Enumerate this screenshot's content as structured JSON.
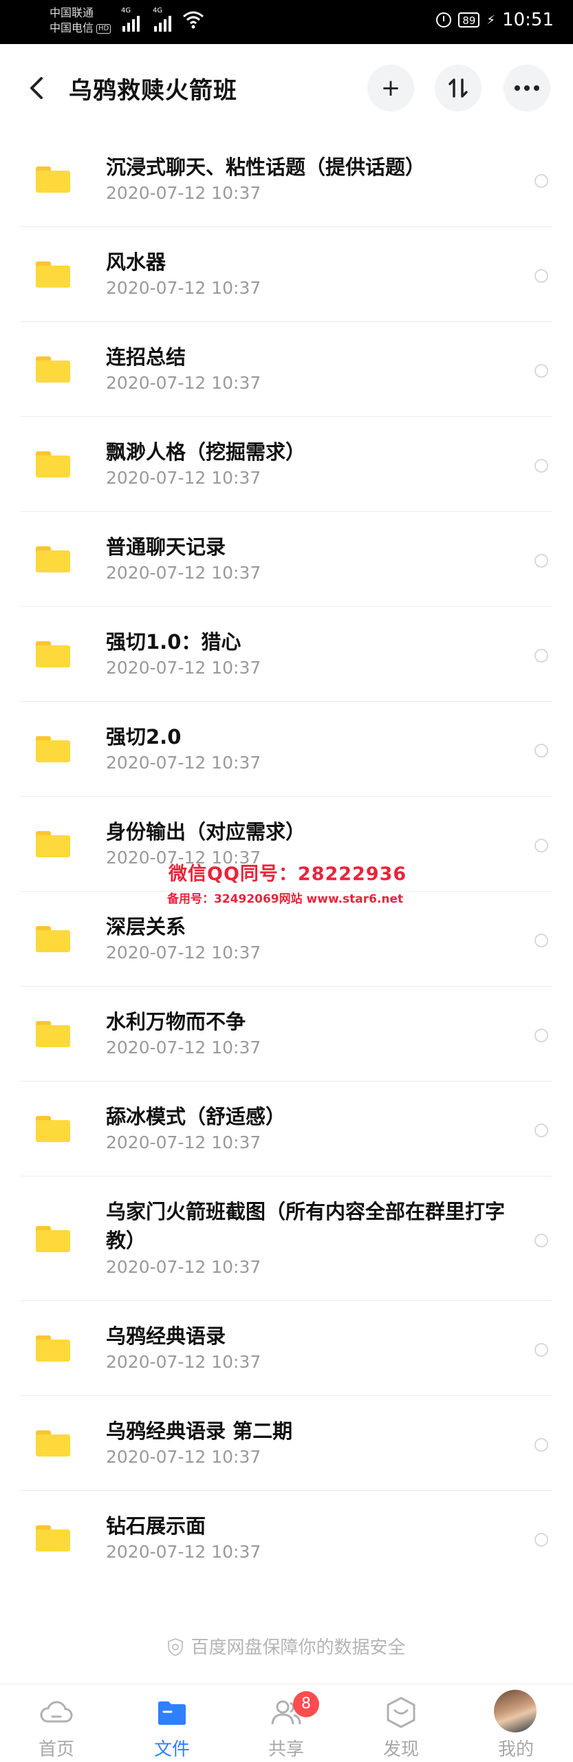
{
  "status_bar": {
    "carrier1": "中国联通",
    "carrier2": "中国电信",
    "hd": "HD",
    "net1": "4G",
    "net2": "4G",
    "battery": "89",
    "time": "10:51"
  },
  "header": {
    "title": "乌鸦救赎火箭班",
    "add_label": "+",
    "sort_label": "⇅",
    "more_label": "•••"
  },
  "files": [
    {
      "name": "沉浸式聊天、粘性话题（提供话题）",
      "date": "2020-07-12  10:37"
    },
    {
      "name": "风水器",
      "date": "2020-07-12  10:37"
    },
    {
      "name": "连招总结",
      "date": "2020-07-12  10:37"
    },
    {
      "name": "飘渺人格（挖掘需求）",
      "date": "2020-07-12  10:37"
    },
    {
      "name": "普通聊天记录",
      "date": "2020-07-12  10:37"
    },
    {
      "name": "强切1.0：猎心",
      "date": "2020-07-12  10:37"
    },
    {
      "name": "强切2.0",
      "date": "2020-07-12  10:37"
    },
    {
      "name": "身份输出（对应需求）",
      "date": "2020-07-12  10:37"
    },
    {
      "name": "深层关系",
      "date": "2020-07-12  10:37"
    },
    {
      "name": "水利万物而不争",
      "date": "2020-07-12  10:37"
    },
    {
      "name": "舔冰模式（舒适感）",
      "date": "2020-07-12  10:37"
    },
    {
      "name": "乌家门火箭班截图（所有内容全部在群里打字教）",
      "date": "2020-07-12  10:37"
    },
    {
      "name": "乌鸦经典语录",
      "date": "2020-07-12  10:37"
    },
    {
      "name": "乌鸦经典语录 第二期",
      "date": "2020-07-12  10:37"
    },
    {
      "name": "钻石展示面",
      "date": "2020-07-12  10:37"
    }
  ],
  "watermark": {
    "line1": "微信QQ同号：28222936",
    "line2": "备用号：32492069网站 www.star6.net"
  },
  "footer_note": "百度网盘保障你的数据安全",
  "tabs": [
    {
      "label": "首页",
      "icon": "cloud-icon"
    },
    {
      "label": "文件",
      "icon": "folder-icon"
    },
    {
      "label": "共享",
      "icon": "people-icon",
      "badge": "8"
    },
    {
      "label": "发现",
      "icon": "discover-icon"
    },
    {
      "label": "我的",
      "icon": "avatar"
    }
  ],
  "colors": {
    "accent": "#2f80ff",
    "folder": "#fdd93b",
    "badge": "#ff4d4f",
    "watermark": "#e8243a"
  }
}
